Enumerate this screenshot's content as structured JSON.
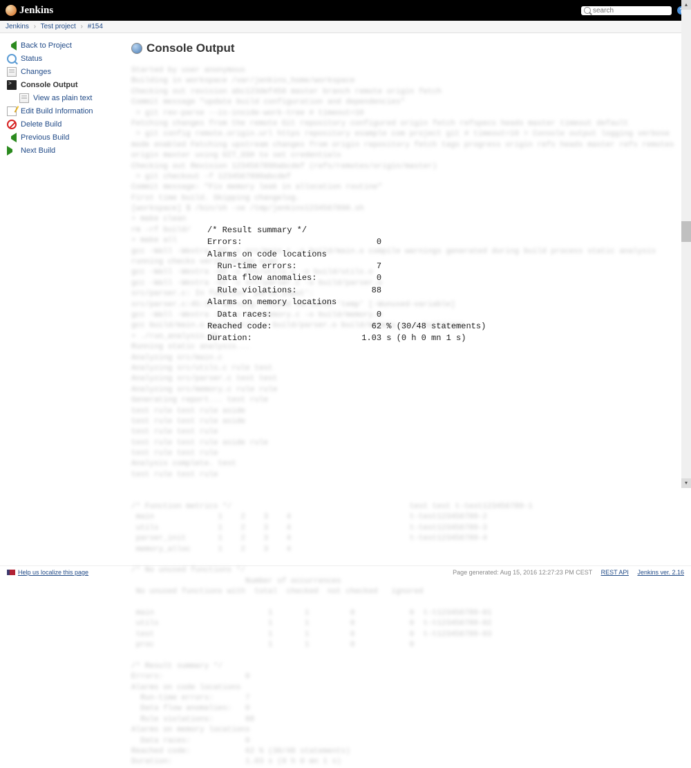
{
  "header": {
    "logo": "Jenkins",
    "search_placeholder": "search"
  },
  "breadcrumb": {
    "items": [
      "Jenkins",
      "Test project",
      "#154"
    ]
  },
  "sidebar": {
    "items": [
      {
        "label": "Back to Project",
        "icon": "arrow-left"
      },
      {
        "label": "Status",
        "icon": "magnify"
      },
      {
        "label": "Changes",
        "icon": "doc"
      },
      {
        "label": "Console Output",
        "icon": "terminal",
        "current": true
      },
      {
        "label": "View as plain text",
        "icon": "doc",
        "sub": true
      },
      {
        "label": "Edit Build Information",
        "icon": "edit"
      },
      {
        "label": "Delete Build",
        "icon": "delete"
      },
      {
        "label": "Previous Build",
        "icon": "arrow-left"
      },
      {
        "label": "Next Build",
        "icon": "arrow-right"
      }
    ]
  },
  "page": {
    "title": "Console Output"
  },
  "console": {
    "summary": "/* Result summary */\nErrors:                           0\nAlarms on code locations\n  Run-time errors:                7\n  Data flow anomalies:            0\n  Rule violations:               88\nAlarms on memory locations\n  Data races:                     0\nReached code:                    62 % (30/48 statements)\nDuration:                      1.03 s (0 h 0 mn 1 s)"
  },
  "footer": {
    "help": "Help us localize this page",
    "generated": "Page generated: Aug 15, 2016 12:27:23 PM CEST",
    "rest": "REST API",
    "version": "Jenkins ver. 2.16"
  }
}
